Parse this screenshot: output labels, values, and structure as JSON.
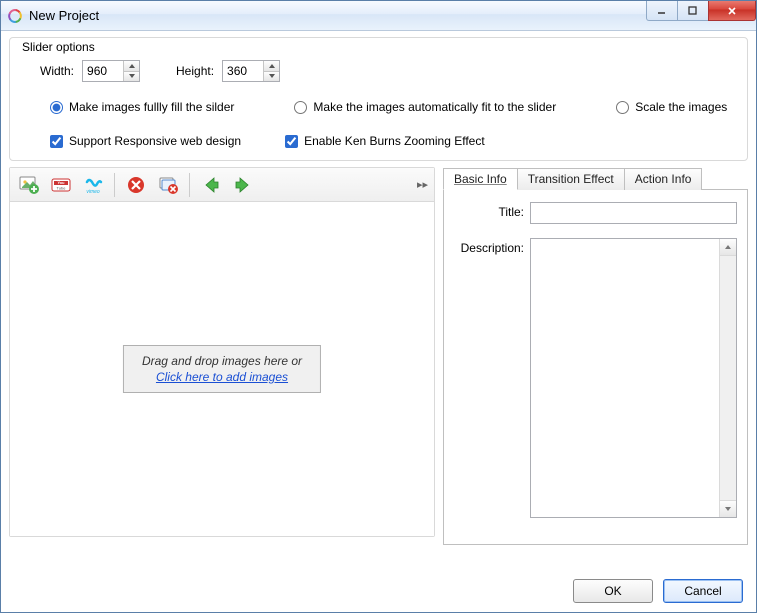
{
  "window": {
    "title": "New Project"
  },
  "slider_options": {
    "legend": "Slider options",
    "width_label": "Width:",
    "width_value": "960",
    "height_label": "Height:",
    "height_value": "360",
    "fit_mode": {
      "fill": "Make images fullly fill the silder",
      "auto": "Make the images automatically fit to the slider",
      "scale": "Scale the images",
      "selected": "fill"
    },
    "responsive_label": "Support Responsive web design",
    "responsive_checked": true,
    "kenburns_label": "Enable Ken Burns Zooming Effect",
    "kenburns_checked": true
  },
  "toolbar": {
    "icons": {
      "add_image": "add-image-icon",
      "youtube": "youtube-icon",
      "vimeo": "vimeo-icon",
      "delete": "delete-icon",
      "delete_all": "delete-all-icon",
      "prev": "arrow-left-icon",
      "next": "arrow-right-icon",
      "collapse": "▸▸"
    }
  },
  "drop_area": {
    "text": "Drag and drop images here or",
    "link": "Click here to add images"
  },
  "tabs": {
    "basic": "Basic Info",
    "transition": "Transition Effect",
    "action": "Action Info",
    "active": "basic"
  },
  "form": {
    "title_label": "Title:",
    "title_value": "",
    "description_label": "Description:",
    "description_value": ""
  },
  "footer": {
    "ok": "OK",
    "cancel": "Cancel"
  }
}
